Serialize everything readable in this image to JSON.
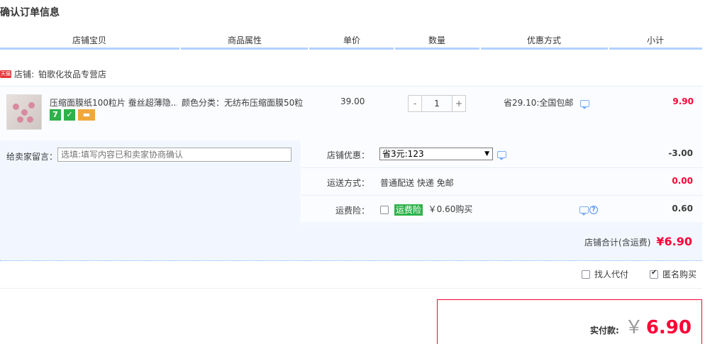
{
  "page": {
    "title": "确认订单信息"
  },
  "columns": [
    "店铺宝贝",
    "商品属性",
    "单价",
    "数量",
    "优惠方式",
    "小计"
  ],
  "shop": {
    "badge": "天猫",
    "label": "店铺:",
    "name": "铂歌化妆品专营店"
  },
  "item": {
    "title": "压缩面膜纸100粒片 蚕丝超薄隐...",
    "icons": [
      {
        "name": "seven-day-return-icon",
        "text": "7",
        "color": "#2eb24a"
      },
      {
        "name": "guarantee-icon",
        "text": "✓",
        "color": "#2eb24a"
      },
      {
        "name": "credit-card-icon",
        "text": "▬",
        "color": "#f0a83a"
      }
    ],
    "attribute": "颜色分类：无纺布压缩面膜50粒",
    "price": "39.00",
    "quantity": "1",
    "qty_minus": "-",
    "qty_plus": "+",
    "discount": "省29.10:全国包邮",
    "subtotal": "9.90"
  },
  "memo": {
    "label": "给卖家留言：",
    "placeholder": "选填:填写内容已和卖家协商确认"
  },
  "options": {
    "coupon": {
      "label": "店铺优惠：",
      "selected": "省3元:123",
      "amount": "-3.00"
    },
    "shipping": {
      "label": "运送方式：",
      "value": "普通配送 快递 免邮",
      "amount": "0.00"
    },
    "insurance": {
      "label": "运费险：",
      "tag": "运费险",
      "price": "￥0.60购买",
      "amount": "0.60"
    }
  },
  "shop_total": {
    "label": "店铺合计(含运费)",
    "value": "¥6.90"
  },
  "extras": {
    "proxy_pay": "找人代付",
    "anonymous": "匿名购买"
  },
  "payment": {
    "label": "实付款:",
    "currency": "￥",
    "value": "6.90"
  },
  "colors": {
    "accent": "#ff0036",
    "header_rule": "#b2d1ff",
    "panel_bg": "#f2f7ff",
    "insurance_green": "#2eb24a"
  }
}
